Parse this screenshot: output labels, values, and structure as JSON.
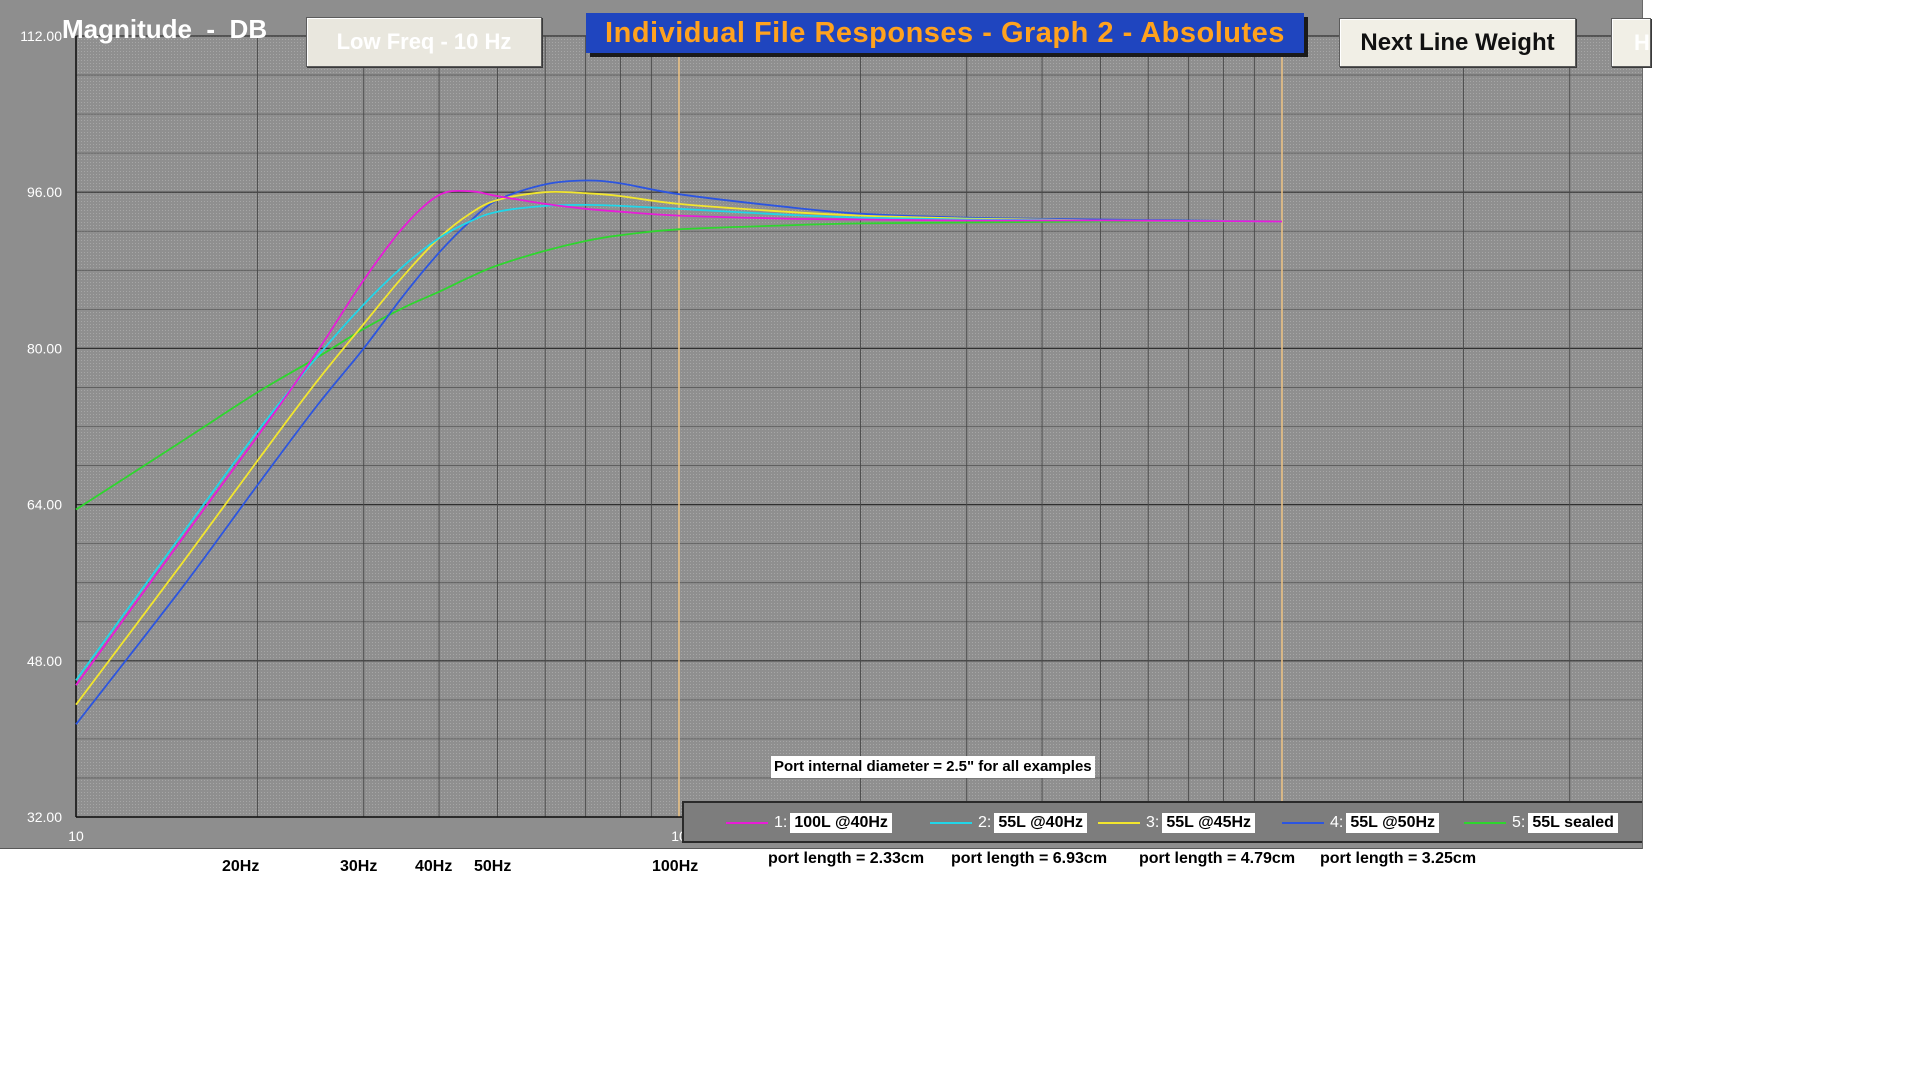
{
  "header": {
    "magnitude_label": "Magnitude  -  DB",
    "low_freq_button": "Low Freq - 10 Hz",
    "title": "Individual File Responses - Graph 2 - Absolutes",
    "next_line_weight_button": "Next Line Weight",
    "partial_button": "H"
  },
  "note": "Port internal diameter = 2.5\" for all examples",
  "axis": {
    "x_origin_label": "10",
    "x_100_partial": "10",
    "x_labels": [
      "20Hz",
      "30Hz",
      "40Hz",
      "50Hz",
      "100Hz"
    ]
  },
  "legend": [
    {
      "num": "1:",
      "label": "100L @40Hz",
      "color": "#e81cd8"
    },
    {
      "num": "2:",
      "label": "55L @40Hz",
      "color": "#21d5e8"
    },
    {
      "num": "3:",
      "label": "55L @45Hz",
      "color": "#f2e62e"
    },
    {
      "num": "4:",
      "label": "55L @50Hz",
      "color": "#2c55e0"
    },
    {
      "num": "5:",
      "label": "55L sealed",
      "color": "#2ed62e"
    }
  ],
  "port_lengths": [
    "port length = 2.33cm",
    "port length = 6.93cm",
    "port length = 4.79cm",
    "port length = 3.25cm"
  ],
  "chart_data": {
    "type": "line",
    "title": "Individual File Responses - Graph 2 - Absolutes",
    "ylabel": "Magnitude  -  DB",
    "xscale": "log",
    "xlim": [
      10,
      1000
    ],
    "ylim": [
      32,
      112
    ],
    "yticks": [
      "112.00",
      "96.00",
      "80.00",
      "64.00",
      "48.00",
      "32.00"
    ],
    "grid": true,
    "marker_lines_hz": [
      100,
      1000
    ],
    "series": [
      {
        "name": "100L @40Hz",
        "color": "#e81cd8",
        "x": [
          10,
          15,
          20,
          25,
          30,
          35,
          40,
          45,
          50,
          60,
          70,
          80,
          100,
          150,
          200,
          300,
          500,
          1000
        ],
        "y": [
          45.5,
          60.5,
          71,
          79.5,
          87,
          92.5,
          95.7,
          96.1,
          95.6,
          94.8,
          94.3,
          94,
          93.6,
          93.3,
          93.2,
          93.1,
          93.1,
          93
        ]
      },
      {
        "name": "55L @40Hz",
        "color": "#21d5e8",
        "x": [
          10,
          15,
          20,
          25,
          30,
          35,
          40,
          45,
          50,
          60,
          70,
          80,
          100,
          150,
          200,
          300,
          500,
          1000
        ],
        "y": [
          46,
          61,
          71.5,
          79,
          84.5,
          88.5,
          91.3,
          93,
          94,
          94.6,
          94.7,
          94.6,
          94.3,
          93.7,
          93.4,
          93.2,
          93.1,
          93
        ]
      },
      {
        "name": "55L @45Hz",
        "color": "#f2e62e",
        "x": [
          10,
          15,
          20,
          25,
          30,
          35,
          40,
          45,
          50,
          60,
          70,
          80,
          100,
          150,
          200,
          300,
          500,
          1000
        ],
        "y": [
          43.5,
          58,
          68.5,
          76.5,
          82.5,
          87.5,
          91.3,
          93.8,
          95.2,
          96,
          95.9,
          95.6,
          94.8,
          94,
          93.6,
          93.3,
          93.1,
          93
        ]
      },
      {
        "name": "55L @50Hz",
        "color": "#2c55e0",
        "x": [
          10,
          15,
          20,
          25,
          30,
          35,
          40,
          45,
          50,
          60,
          70,
          80,
          100,
          150,
          200,
          300,
          500,
          1000
        ],
        "y": [
          41.5,
          55.5,
          66,
          74,
          80,
          85.5,
          89.8,
          93,
          95.2,
          96.8,
          97.2,
          96.9,
          95.8,
          94.5,
          93.8,
          93.4,
          93.2,
          93
        ]
      },
      {
        "name": "55L sealed",
        "color": "#2ed62e",
        "x": [
          10,
          15,
          20,
          25,
          30,
          35,
          40,
          45,
          50,
          60,
          70,
          80,
          100,
          150,
          200,
          300,
          500,
          1000
        ],
        "y": [
          63.5,
          70.5,
          75.5,
          79,
          82,
          84.2,
          85.8,
          87.3,
          88.5,
          90,
          91,
          91.6,
          92.2,
          92.6,
          92.8,
          92.9,
          93,
          93
        ]
      }
    ]
  }
}
